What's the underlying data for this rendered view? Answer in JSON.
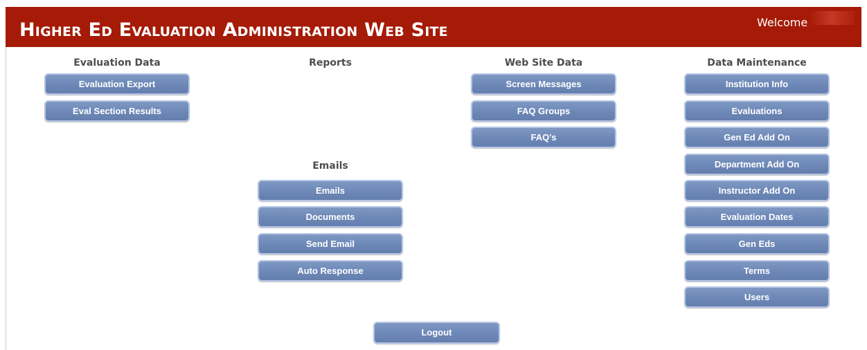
{
  "header": {
    "title": "Higher Ed Evaluation Administration Web Site",
    "welcome_label": "Welcome"
  },
  "colors": {
    "header_bg": "#a51b07",
    "button_bg": "#7089b8",
    "button_border": "#b7c6e6",
    "heading_text": "#4d4d4d"
  },
  "sections": {
    "evaluation_data": {
      "title": "Evaluation Data",
      "buttons": [
        "Evaluation Export",
        "Eval Section Results"
      ]
    },
    "reports": {
      "title": "Reports",
      "buttons": []
    },
    "emails": {
      "title": "Emails",
      "buttons": [
        "Emails",
        "Documents",
        "Send Email",
        "Auto Response"
      ]
    },
    "web_site_data": {
      "title": "Web Site Data",
      "buttons": [
        "Screen Messages",
        "FAQ Groups",
        "FAQ's"
      ]
    },
    "data_maintenance": {
      "title": "Data Maintenance",
      "buttons": [
        "Institution Info",
        "Evaluations",
        "Gen Ed Add On",
        "Department Add On",
        "Instructor Add On",
        "Evaluation Dates",
        "Gen Eds",
        "Terms",
        "Users"
      ]
    }
  },
  "footer": {
    "logout_label": "Logout"
  }
}
